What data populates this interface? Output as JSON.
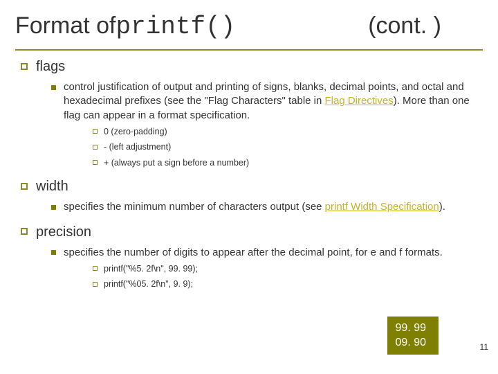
{
  "title": {
    "prefix": "Format of ",
    "code": "printf()",
    "suffix": "(cont. )"
  },
  "sections": {
    "flags": {
      "label": "flags",
      "desc_pre": "control justification of output and printing of signs, blanks, decimal points, and octal and hexadecimal prefixes (see the \"Flag Characters\" table in ",
      "desc_link": "Flag Directives",
      "desc_post": "). More than one flag can appear in a format specification.",
      "items": [
        "0 (zero-padding)",
        "- (left adjustment)",
        "+ (always put a sign before a number)"
      ]
    },
    "width": {
      "label": "width",
      "desc_pre": "specifies the minimum number of characters output (see ",
      "desc_link": "printf Width Specification",
      "desc_post": ")."
    },
    "precision": {
      "label": "precision",
      "desc": "specifies the number of digits to appear after the decimal point, for e and f formats.",
      "examples": [
        "printf(\"%5. 2f\\n\", 99. 99);",
        "printf(\"%05. 2f\\n\", 9. 9);"
      ]
    }
  },
  "output_box": {
    "line1": "99. 99",
    "line2": "09. 90"
  },
  "page_number": "11"
}
